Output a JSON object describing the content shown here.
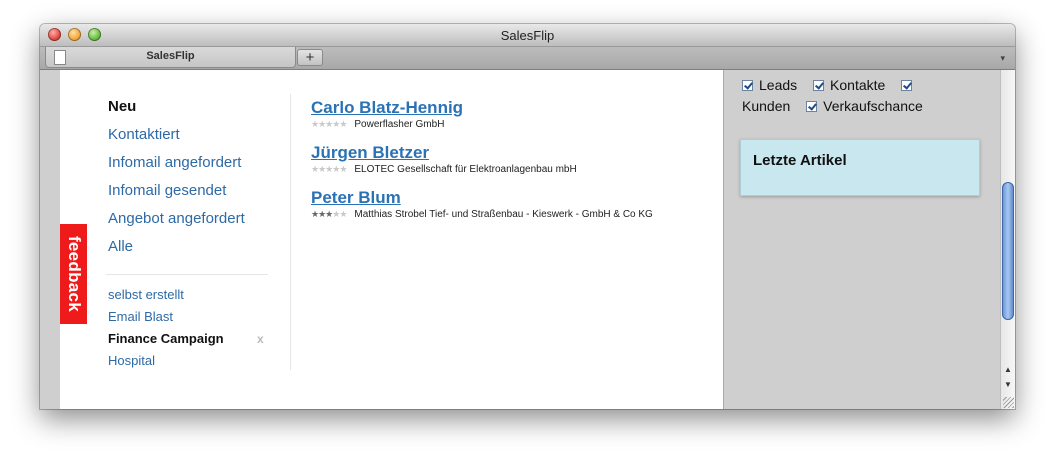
{
  "window": {
    "title": "SalesFlip",
    "tab_label": "SalesFlip",
    "tab_add": "+",
    "tab_menu": "▾"
  },
  "feedback": {
    "label": "feedback"
  },
  "sidebar": {
    "statuses": [
      {
        "label": "Neu",
        "active": true
      },
      {
        "label": "Kontaktiert",
        "active": false
      },
      {
        "label": "Infomail angefordert",
        "active": false
      },
      {
        "label": "Infomail gesendet",
        "active": false
      },
      {
        "label": "Angebot angefordert",
        "active": false
      },
      {
        "label": "Alle",
        "active": false
      }
    ],
    "campaigns": [
      {
        "label": "selbst erstellt",
        "active": false
      },
      {
        "label": "Email Blast",
        "active": false
      },
      {
        "label": "Finance Campaign",
        "active": true,
        "remove": "x"
      },
      {
        "label": "Hospital",
        "active": false
      }
    ]
  },
  "results": [
    {
      "name": "Carlo Blatz-Hennig",
      "company": "Powerflasher GmbH",
      "rating": 0,
      "stars": 5
    },
    {
      "name": "Jürgen Bletzer",
      "company": "ELOTEC Gesellschaft für Elektroanlagenbau mbH",
      "rating": 0,
      "stars": 5
    },
    {
      "name": "Peter Blum",
      "company": "Matthias Strobel Tief- und Straßenbau - Kieswerk - GmbH & Co KG",
      "rating": 3,
      "stars": 5
    }
  ],
  "filters": {
    "leads": {
      "label": "Leads",
      "checked": true
    },
    "kontakte": {
      "label": "Kontakte",
      "checked": true
    },
    "kunden": {
      "label": "Kunden",
      "checked": true
    },
    "verkaufschance": {
      "label": "Verkaufschance",
      "checked": true
    }
  },
  "recent": {
    "title": "Letzte Artikel"
  },
  "scroll": {
    "up": "▲",
    "down": "▼"
  },
  "colors": {
    "link": "#2a72b4",
    "feedback": "#ef1b1b",
    "article_box": "#c9e7ee"
  }
}
